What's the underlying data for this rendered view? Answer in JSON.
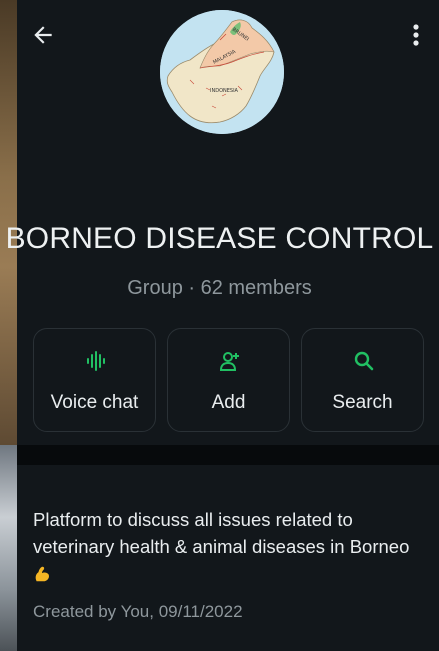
{
  "group": {
    "name": "BORNEO DISEASE CONTROL",
    "subtitle": "Group · 62 members",
    "map_labels": [
      "BRUNEI",
      "MALAYSIA",
      "INDONESIA"
    ]
  },
  "actions": [
    {
      "label": "Voice chat",
      "icon": "voice-chat-icon"
    },
    {
      "label": "Add",
      "icon": "add-person-icon"
    },
    {
      "label": "Search",
      "icon": "search-icon"
    }
  ],
  "about": {
    "description": "Platform to discuss all issues related to veterinary health & animal diseases in Borneo",
    "emoji": "flexed-biceps-emoji",
    "created": "Created by You, 09/11/2022"
  },
  "colors": {
    "accent": "#21c063",
    "background": "#12171b",
    "text": "#e9edef",
    "muted": "#8e979c"
  }
}
